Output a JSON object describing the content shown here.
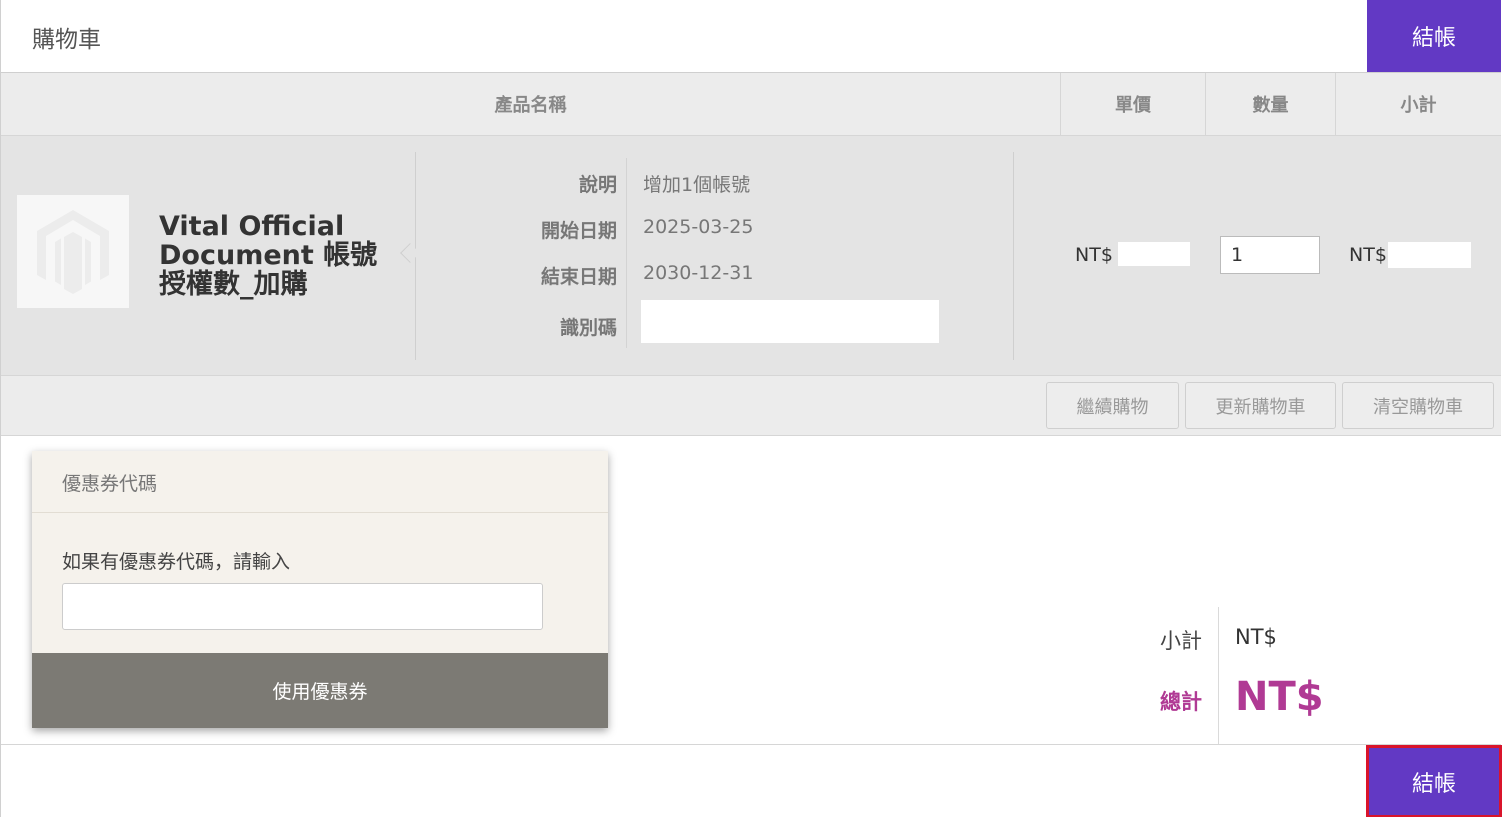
{
  "header": {
    "title": "購物車",
    "checkout_label": "結帳"
  },
  "table": {
    "columns": {
      "name": "產品名稱",
      "price": "單價",
      "qty": "數量",
      "subtotal": "小計"
    }
  },
  "item": {
    "name": "Vital Official Document 帳號授權數_加購",
    "options": [
      {
        "label": "說明",
        "value": "增加1個帳號"
      },
      {
        "label": "開始日期",
        "value": "2025-03-25"
      },
      {
        "label": "結束日期",
        "value": "2030-12-31"
      },
      {
        "label": "識別碼",
        "value": ""
      }
    ],
    "unit_price_prefix": "NT$",
    "quantity": "1",
    "subtotal_prefix": "NT$"
  },
  "actions": {
    "continue": "繼續購物",
    "update": "更新購物車",
    "clear": "清空購物車"
  },
  "coupon": {
    "title": "優惠券代碼",
    "prompt": "如果有優惠券代碼，請輸入",
    "input_value": "",
    "apply_label": "使用優惠券"
  },
  "totals": {
    "subtotal_label": "小計",
    "subtotal_value": "NT$",
    "grand_total_label": "總計",
    "grand_total_value": "NT$"
  },
  "footer": {
    "checkout_label": "結帳"
  },
  "colors": {
    "accent": "#6239c4",
    "total": "#b03a94",
    "highlight_border": "#d9142b"
  }
}
